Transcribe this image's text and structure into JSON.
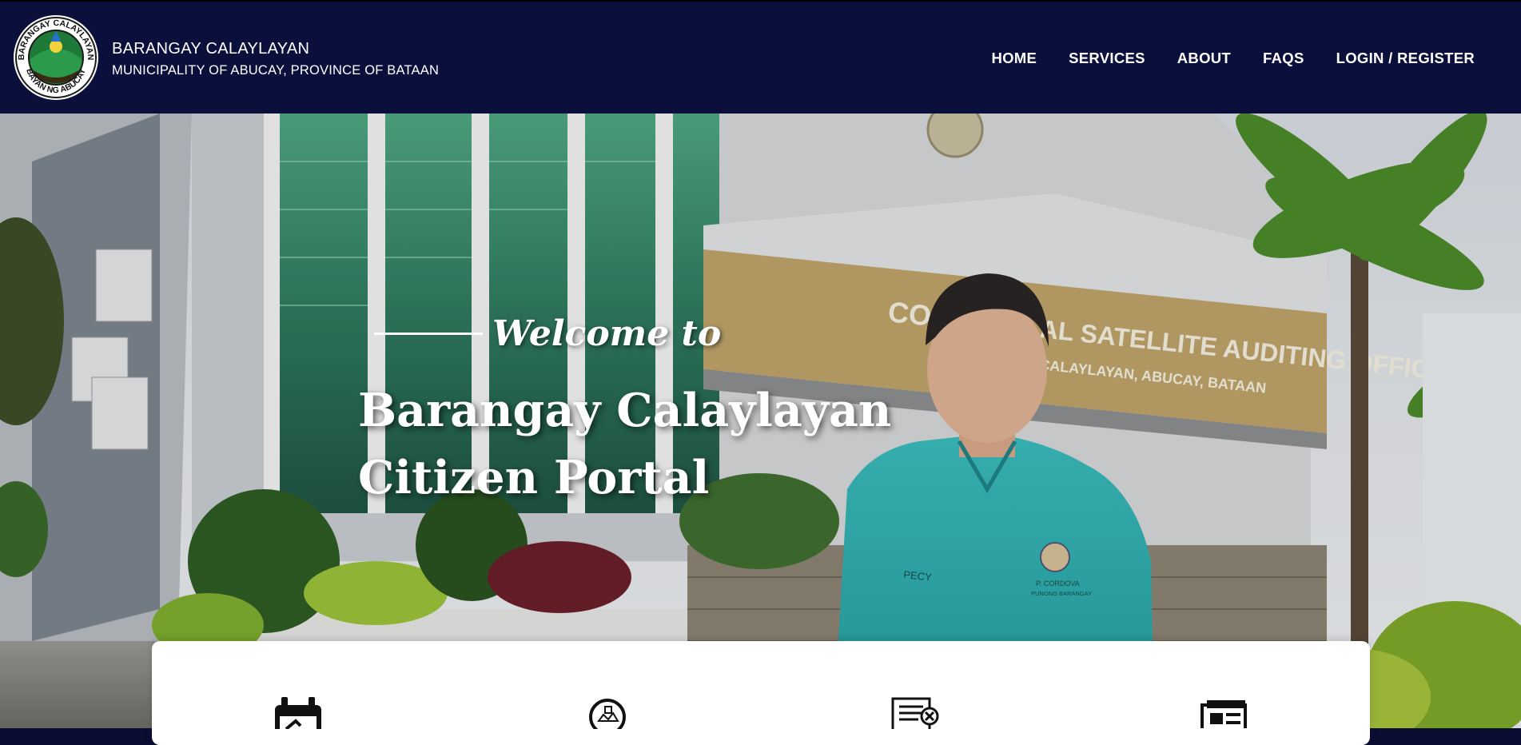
{
  "header": {
    "title": "BARANGAY CALAYLAYAN",
    "subtitle": "MUNICIPALITY OF ABUCAY, PROVINCE OF BATAAN",
    "logo_text": "BARANGAY CALAYLAYAN BAYAN NG ABUCAY"
  },
  "nav": {
    "items": [
      {
        "label": "HOME"
      },
      {
        "label": "SERVICES"
      },
      {
        "label": "ABOUT"
      },
      {
        "label": "FAQS"
      },
      {
        "label": "LOGIN / REGISTER"
      }
    ]
  },
  "hero": {
    "welcome": "Welcome to",
    "title_line1": "Barangay Calaylayan",
    "title_line2": "Citizen Portal",
    "building_sign_line1": "COA ... AL SATELLITE AUDITING OFFICE",
    "building_sign_line2": "CALAYLAYAN, ABUCAY, BATAAN",
    "shirt_name": "PECY",
    "shirt_tag_line1": "P. CORDOVA",
    "shirt_tag_line2": "PUNONG BARANGAY"
  },
  "services": {
    "icons": [
      "calendar-icon",
      "location-search-icon",
      "document-cancel-icon",
      "newspaper-icon"
    ]
  },
  "colors": {
    "navbar": "#0a0f3c",
    "nav_text": "#ffffff",
    "panel": "#ffffff"
  }
}
